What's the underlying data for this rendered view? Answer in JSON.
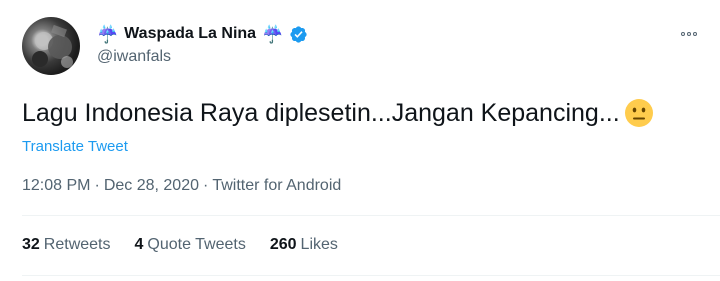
{
  "author": {
    "display_name": "Waspada La Nina",
    "name_prefix_emoji": "☔",
    "name_suffix_emoji": "☔",
    "handle": "@iwanfals",
    "verified": true
  },
  "tweet": {
    "text": "Lagu Indonesia Raya diplesetin...Jangan Kepancing...",
    "trailing_emoji": "neutral-face-emoji",
    "translate_label": "Translate Tweet"
  },
  "meta": {
    "time": "12:08 PM",
    "separator": "·",
    "date": "Dec 28, 2020",
    "source": "Twitter for Android"
  },
  "stats": {
    "retweets_count": "32",
    "retweets_label": "Retweets",
    "quote_count": "4",
    "quote_label": "Quote Tweets",
    "likes_count": "260",
    "likes_label": "Likes"
  },
  "colors": {
    "link_blue": "#1d9bf0",
    "muted_text": "#536471",
    "main_text": "#0f1419",
    "verified_badge": "#1d9bf0",
    "divider": "#eff3f4"
  }
}
